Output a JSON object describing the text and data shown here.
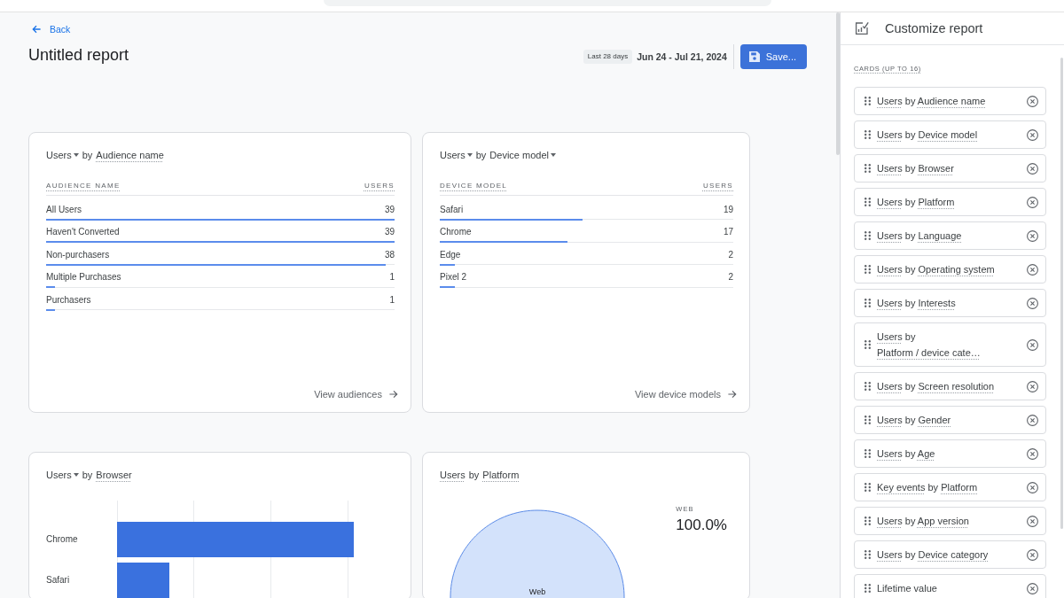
{
  "header": {
    "back": "Back",
    "title": "Untitled report",
    "date_range": {
      "preset": "Last 28 days",
      "range": "Jun 24 - Jul 21, 2024"
    },
    "save_button": "Save..."
  },
  "cards": [
    {
      "kind": "table",
      "title": {
        "metric": {
          "text": "Users",
          "dropdown": true
        },
        "connector": "by",
        "dimension": {
          "text": "Audience name",
          "dropdown": false
        }
      },
      "columns": [
        "AUDIENCE NAME",
        "USERS"
      ],
      "rows": [
        {
          "name": "All Users",
          "value": "39",
          "level": 1
        },
        {
          "name": "Haven't Converted",
          "value": "39",
          "level": 1
        },
        {
          "name": "Non-purchasers",
          "value": "38",
          "level": 0.974
        },
        {
          "name": "Multiple Purchases",
          "value": "1",
          "level": 0.026
        },
        {
          "name": "Purchasers",
          "value": "1",
          "level": 0.026
        }
      ],
      "footer_link": "View audiences"
    },
    {
      "kind": "table",
      "title": {
        "metric": {
          "text": "Users",
          "dropdown": true
        },
        "connector": "by",
        "dimension": {
          "text": "Device model",
          "dropdown": true
        }
      },
      "columns": [
        "DEVICE MODEL",
        "USERS"
      ],
      "rows": [
        {
          "name": "Safari",
          "value": "19",
          "level": 0.487
        },
        {
          "name": "Chrome",
          "value": "17",
          "level": 0.436
        },
        {
          "name": "Edge",
          "value": "2",
          "level": 0.051
        },
        {
          "name": "Pixel 2",
          "value": "2",
          "level": 0.051
        }
      ],
      "footer_link": "View device models"
    },
    {
      "kind": "bar_chart",
      "title": {
        "metric": {
          "text": "Users",
          "dropdown": true
        },
        "connector": "by",
        "dimension": {
          "text": "Browser",
          "dropdown": false
        }
      },
      "bars": [
        {
          "label": "Chrome"
        },
        {
          "label": "Safari"
        }
      ]
    },
    {
      "kind": "pie_chart",
      "title": {
        "metric": {
          "text": "Users",
          "dropdown": false
        },
        "connector": "by",
        "dimension": {
          "text": "Platform",
          "dropdown": false
        }
      },
      "slices": [
        {
          "label": "Web"
        }
      ],
      "legend": [
        {
          "label": "WEB",
          "value": "100.0%"
        }
      ]
    }
  ],
  "panel": {
    "title": "Customize report",
    "section_label": "CARDS (UP TO 16)",
    "items": [
      {
        "kind": "metric_by_dimension",
        "metric": "Users",
        "connector": "by",
        "dimension": "Audience name"
      },
      {
        "kind": "metric_by_dimension",
        "metric": "Users",
        "connector": "by",
        "dimension": "Device model"
      },
      {
        "kind": "metric_by_dimension",
        "metric": "Users",
        "connector": "by",
        "dimension": "Browser"
      },
      {
        "kind": "metric_by_dimension",
        "metric": "Users",
        "connector": "by",
        "dimension": "Platform"
      },
      {
        "kind": "metric_by_dimension",
        "metric": "Users",
        "connector": "by",
        "dimension": "Language"
      },
      {
        "kind": "metric_by_dimension",
        "metric": "Users",
        "connector": "by",
        "dimension": "Operating system"
      },
      {
        "kind": "metric_by_dimension",
        "metric": "Users",
        "connector": "by",
        "dimension": "Interests"
      },
      {
        "kind": "metric_by_dimension",
        "metric": "Users",
        "connector": "by",
        "dimension": "Platform / device cate…"
      },
      {
        "kind": "metric_by_dimension",
        "metric": "Users",
        "connector": "by",
        "dimension": "Screen resolution"
      },
      {
        "kind": "metric_by_dimension",
        "metric": "Users",
        "connector": "by",
        "dimension": "Gender"
      },
      {
        "kind": "metric_by_dimension",
        "metric": "Users",
        "connector": "by",
        "dimension": "Age"
      },
      {
        "kind": "metric_by_dimension",
        "metric": "Key events",
        "connector": "by",
        "dimension": "Platform"
      },
      {
        "kind": "metric_by_dimension",
        "metric": "Users",
        "connector": "by",
        "dimension": "App version"
      },
      {
        "kind": "metric_by_dimension",
        "metric": "Users",
        "connector": "by",
        "dimension": "Device category"
      },
      {
        "kind": "plain",
        "text": "Lifetime value"
      }
    ]
  }
}
